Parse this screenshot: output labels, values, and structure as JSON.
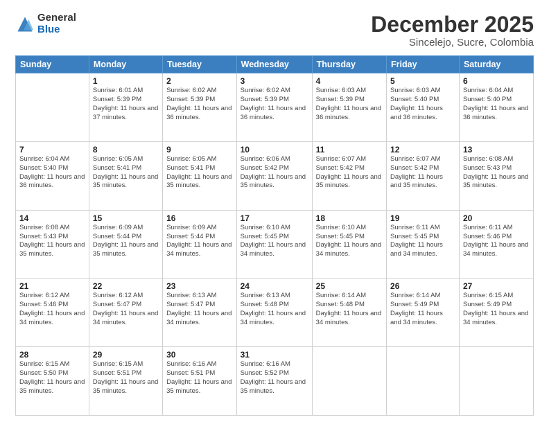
{
  "logo": {
    "general": "General",
    "blue": "Blue"
  },
  "title": "December 2025",
  "subtitle": "Sincelejo, Sucre, Colombia",
  "days_of_week": [
    "Sunday",
    "Monday",
    "Tuesday",
    "Wednesday",
    "Thursday",
    "Friday",
    "Saturday"
  ],
  "weeks": [
    [
      {
        "day": "",
        "sunrise": "",
        "sunset": "",
        "daylight": ""
      },
      {
        "day": "1",
        "sunrise": "Sunrise: 6:01 AM",
        "sunset": "Sunset: 5:39 PM",
        "daylight": "Daylight: 11 hours and 37 minutes."
      },
      {
        "day": "2",
        "sunrise": "Sunrise: 6:02 AM",
        "sunset": "Sunset: 5:39 PM",
        "daylight": "Daylight: 11 hours and 36 minutes."
      },
      {
        "day": "3",
        "sunrise": "Sunrise: 6:02 AM",
        "sunset": "Sunset: 5:39 PM",
        "daylight": "Daylight: 11 hours and 36 minutes."
      },
      {
        "day": "4",
        "sunrise": "Sunrise: 6:03 AM",
        "sunset": "Sunset: 5:39 PM",
        "daylight": "Daylight: 11 hours and 36 minutes."
      },
      {
        "day": "5",
        "sunrise": "Sunrise: 6:03 AM",
        "sunset": "Sunset: 5:40 PM",
        "daylight": "Daylight: 11 hours and 36 minutes."
      },
      {
        "day": "6",
        "sunrise": "Sunrise: 6:04 AM",
        "sunset": "Sunset: 5:40 PM",
        "daylight": "Daylight: 11 hours and 36 minutes."
      }
    ],
    [
      {
        "day": "7",
        "sunrise": "Sunrise: 6:04 AM",
        "sunset": "Sunset: 5:40 PM",
        "daylight": "Daylight: 11 hours and 36 minutes."
      },
      {
        "day": "8",
        "sunrise": "Sunrise: 6:05 AM",
        "sunset": "Sunset: 5:41 PM",
        "daylight": "Daylight: 11 hours and 35 minutes."
      },
      {
        "day": "9",
        "sunrise": "Sunrise: 6:05 AM",
        "sunset": "Sunset: 5:41 PM",
        "daylight": "Daylight: 11 hours and 35 minutes."
      },
      {
        "day": "10",
        "sunrise": "Sunrise: 6:06 AM",
        "sunset": "Sunset: 5:42 PM",
        "daylight": "Daylight: 11 hours and 35 minutes."
      },
      {
        "day": "11",
        "sunrise": "Sunrise: 6:07 AM",
        "sunset": "Sunset: 5:42 PM",
        "daylight": "Daylight: 11 hours and 35 minutes."
      },
      {
        "day": "12",
        "sunrise": "Sunrise: 6:07 AM",
        "sunset": "Sunset: 5:42 PM",
        "daylight": "Daylight: 11 hours and 35 minutes."
      },
      {
        "day": "13",
        "sunrise": "Sunrise: 6:08 AM",
        "sunset": "Sunset: 5:43 PM",
        "daylight": "Daylight: 11 hours and 35 minutes."
      }
    ],
    [
      {
        "day": "14",
        "sunrise": "Sunrise: 6:08 AM",
        "sunset": "Sunset: 5:43 PM",
        "daylight": "Daylight: 11 hours and 35 minutes."
      },
      {
        "day": "15",
        "sunrise": "Sunrise: 6:09 AM",
        "sunset": "Sunset: 5:44 PM",
        "daylight": "Daylight: 11 hours and 35 minutes."
      },
      {
        "day": "16",
        "sunrise": "Sunrise: 6:09 AM",
        "sunset": "Sunset: 5:44 PM",
        "daylight": "Daylight: 11 hours and 34 minutes."
      },
      {
        "day": "17",
        "sunrise": "Sunrise: 6:10 AM",
        "sunset": "Sunset: 5:45 PM",
        "daylight": "Daylight: 11 hours and 34 minutes."
      },
      {
        "day": "18",
        "sunrise": "Sunrise: 6:10 AM",
        "sunset": "Sunset: 5:45 PM",
        "daylight": "Daylight: 11 hours and 34 minutes."
      },
      {
        "day": "19",
        "sunrise": "Sunrise: 6:11 AM",
        "sunset": "Sunset: 5:45 PM",
        "daylight": "Daylight: 11 hours and 34 minutes."
      },
      {
        "day": "20",
        "sunrise": "Sunrise: 6:11 AM",
        "sunset": "Sunset: 5:46 PM",
        "daylight": "Daylight: 11 hours and 34 minutes."
      }
    ],
    [
      {
        "day": "21",
        "sunrise": "Sunrise: 6:12 AM",
        "sunset": "Sunset: 5:46 PM",
        "daylight": "Daylight: 11 hours and 34 minutes."
      },
      {
        "day": "22",
        "sunrise": "Sunrise: 6:12 AM",
        "sunset": "Sunset: 5:47 PM",
        "daylight": "Daylight: 11 hours and 34 minutes."
      },
      {
        "day": "23",
        "sunrise": "Sunrise: 6:13 AM",
        "sunset": "Sunset: 5:47 PM",
        "daylight": "Daylight: 11 hours and 34 minutes."
      },
      {
        "day": "24",
        "sunrise": "Sunrise: 6:13 AM",
        "sunset": "Sunset: 5:48 PM",
        "daylight": "Daylight: 11 hours and 34 minutes."
      },
      {
        "day": "25",
        "sunrise": "Sunrise: 6:14 AM",
        "sunset": "Sunset: 5:48 PM",
        "daylight": "Daylight: 11 hours and 34 minutes."
      },
      {
        "day": "26",
        "sunrise": "Sunrise: 6:14 AM",
        "sunset": "Sunset: 5:49 PM",
        "daylight": "Daylight: 11 hours and 34 minutes."
      },
      {
        "day": "27",
        "sunrise": "Sunrise: 6:15 AM",
        "sunset": "Sunset: 5:49 PM",
        "daylight": "Daylight: 11 hours and 34 minutes."
      }
    ],
    [
      {
        "day": "28",
        "sunrise": "Sunrise: 6:15 AM",
        "sunset": "Sunset: 5:50 PM",
        "daylight": "Daylight: 11 hours and 35 minutes."
      },
      {
        "day": "29",
        "sunrise": "Sunrise: 6:15 AM",
        "sunset": "Sunset: 5:51 PM",
        "daylight": "Daylight: 11 hours and 35 minutes."
      },
      {
        "day": "30",
        "sunrise": "Sunrise: 6:16 AM",
        "sunset": "Sunset: 5:51 PM",
        "daylight": "Daylight: 11 hours and 35 minutes."
      },
      {
        "day": "31",
        "sunrise": "Sunrise: 6:16 AM",
        "sunset": "Sunset: 5:52 PM",
        "daylight": "Daylight: 11 hours and 35 minutes."
      },
      {
        "day": "",
        "sunrise": "",
        "sunset": "",
        "daylight": ""
      },
      {
        "day": "",
        "sunrise": "",
        "sunset": "",
        "daylight": ""
      },
      {
        "day": "",
        "sunrise": "",
        "sunset": "",
        "daylight": ""
      }
    ]
  ]
}
